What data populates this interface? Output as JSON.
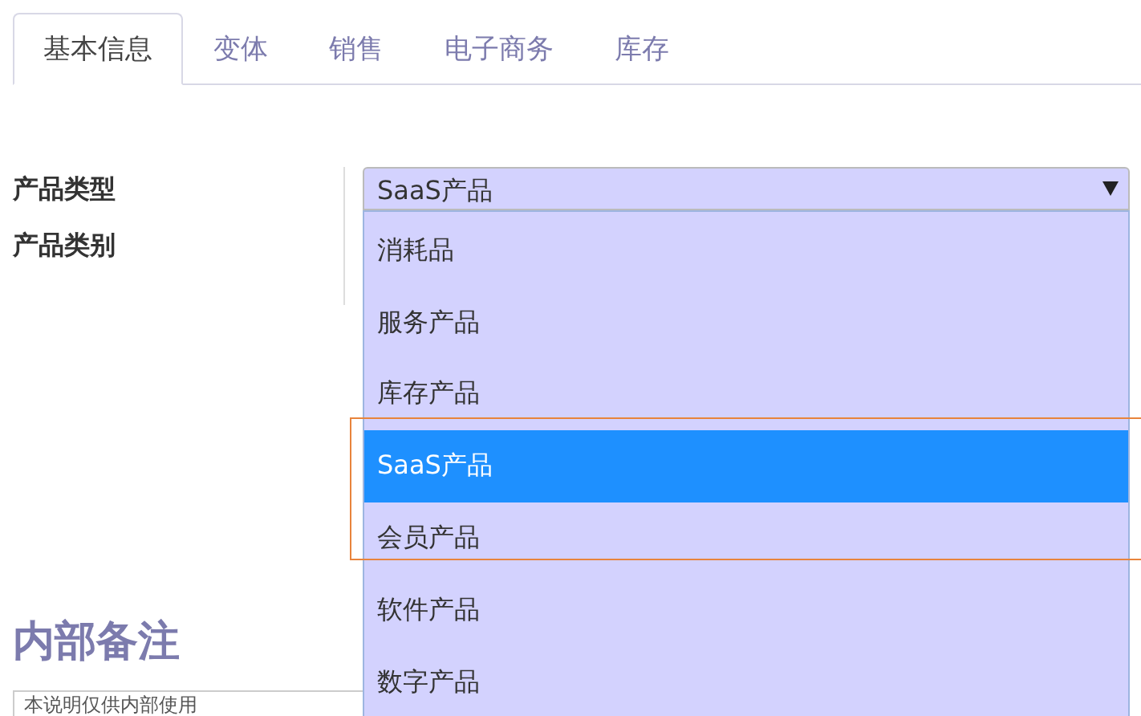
{
  "tabs": [
    {
      "label": "基本信息",
      "selected": true
    },
    {
      "label": "变体",
      "selected": false
    },
    {
      "label": "销售",
      "selected": false
    },
    {
      "label": "电子商务",
      "selected": false
    },
    {
      "label": "库存",
      "selected": false
    }
  ],
  "fields": [
    {
      "label": "产品类型"
    },
    {
      "label": "产品类别"
    }
  ],
  "product_type_select": {
    "value": "SaaS产品",
    "expanded": true,
    "options": [
      {
        "label": "消耗品",
        "selected": false
      },
      {
        "label": "服务产品",
        "selected": false
      },
      {
        "label": "库存产品",
        "selected": false
      },
      {
        "label": "SaaS产品",
        "selected": true
      },
      {
        "label": "会员产品",
        "selected": false
      },
      {
        "label": "软件产品",
        "selected": false
      },
      {
        "label": "数字产品",
        "selected": false
      }
    ]
  },
  "internal_notes": {
    "heading": "内部备注",
    "placeholder": "本说明仅供内部使用"
  }
}
